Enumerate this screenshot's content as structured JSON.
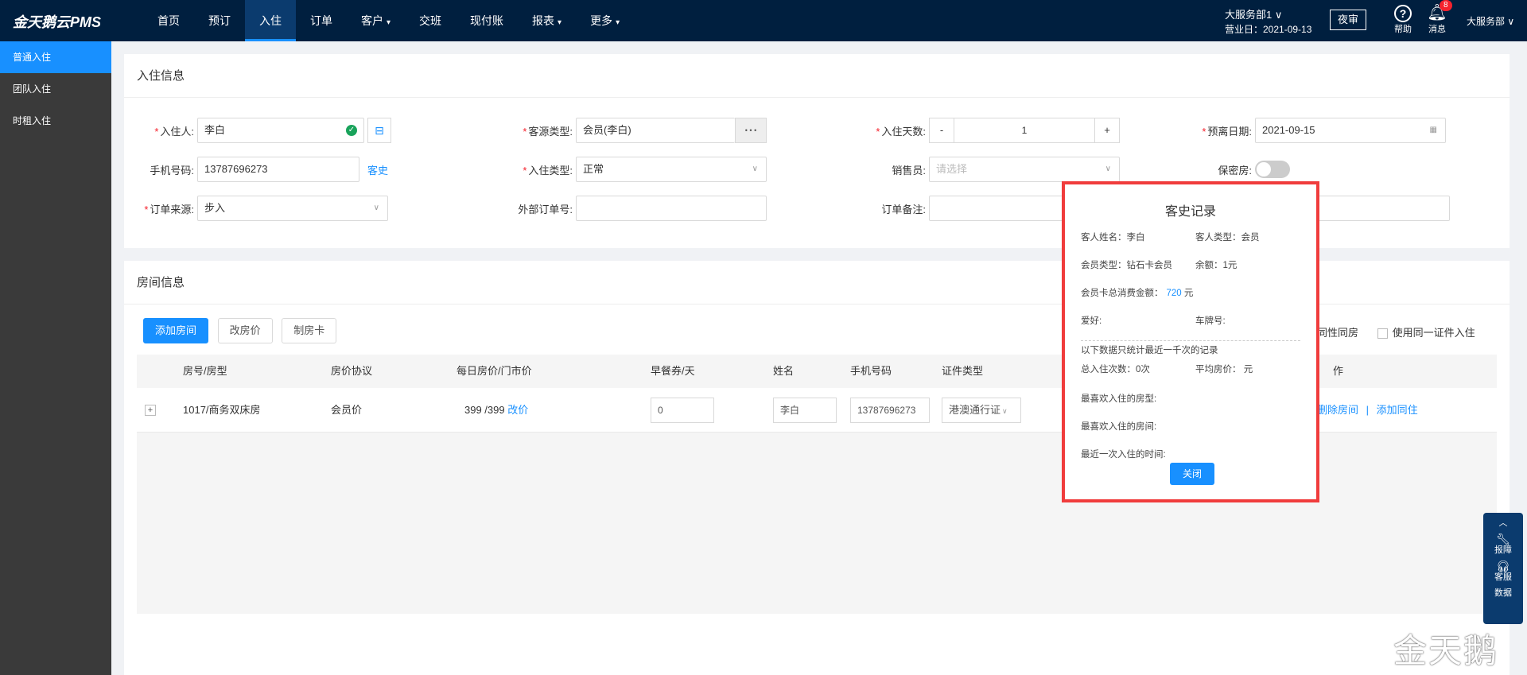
{
  "app": {
    "logo": "金天鹅云PMS"
  },
  "nav": {
    "items": [
      {
        "label": "首页",
        "caret": false
      },
      {
        "label": "预订",
        "caret": false
      },
      {
        "label": "入住",
        "caret": false,
        "active": true
      },
      {
        "label": "订单",
        "caret": false
      },
      {
        "label": "客户",
        "caret": true
      },
      {
        "label": "交班",
        "caret": false
      },
      {
        "label": "现付账",
        "caret": false
      },
      {
        "label": "报表",
        "caret": true
      },
      {
        "label": "更多",
        "caret": true
      }
    ]
  },
  "topbar": {
    "dept": "大服务部1 ∨",
    "biz_day": "营业日：2021-09-13",
    "night_audit": "夜审",
    "help": "帮助",
    "messages": "消息",
    "message_count": "8",
    "user": "大服务部 ∨"
  },
  "sidebar": {
    "items": [
      {
        "label": "普通入住",
        "active": true
      },
      {
        "label": "团队入住"
      },
      {
        "label": "时租入住"
      }
    ]
  },
  "checkin": {
    "title": "入住信息",
    "guest": {
      "label": "入住人:",
      "value": "李白"
    },
    "source_type": {
      "label": "客源类型:",
      "value": "会员(李白)",
      "more": "• • •"
    },
    "days": {
      "label": "入住天数:",
      "minus": "-",
      "value": "1",
      "plus": "+"
    },
    "departure": {
      "label": "预离日期:",
      "value": "2021-09-15"
    },
    "phone": {
      "label": "手机号码:",
      "value": "13787696273",
      "history_link": "客史"
    },
    "checkin_type": {
      "label": "入住类型:",
      "value": "正常"
    },
    "sales": {
      "label": "销售员:",
      "placeholder": "请选择"
    },
    "secret": {
      "label": "保密房:"
    },
    "order_source": {
      "label": "订单来源:",
      "value": "步入"
    },
    "external_no": {
      "label": "外部订单号:",
      "value": ""
    },
    "remark": {
      "label": "订单备注:",
      "value": ""
    }
  },
  "rooms": {
    "title": "房间信息",
    "buttons": {
      "add": "添加房间",
      "change_price": "改房价",
      "make_card": "制房卡"
    },
    "options": {
      "same_sex": "同性同房",
      "same_id": "使用同一证件入住"
    },
    "headers": {
      "room": "房号/房型",
      "protocol": "房价协议",
      "price": "每日房价/门市价",
      "breakfast": "早餐券/天",
      "name": "姓名",
      "phone": "手机号码",
      "id_type": "证件类型",
      "action": "作"
    },
    "row": {
      "expand": "+",
      "room": "1017/商务双床房",
      "protocol": "会员价",
      "price": "399 /399",
      "change_link": "改价",
      "breakfast": "0",
      "name": "李白",
      "phone": "13787696273",
      "id_type": "港澳通行证",
      "delete": "删除房间",
      "sep": "|",
      "add_companion": "添加同住"
    }
  },
  "history_popup": {
    "title": "客史记录",
    "guest_name": "客人姓名：李白",
    "guest_type": "客人类型：会员",
    "member_type": "会员类型：钻石卡会员",
    "balance": "余额：1元",
    "total_spend_label": "会员卡总消费金额：",
    "total_spend_value": "720",
    "total_spend_unit": " 元",
    "hobby": "爱好:",
    "plate": "车牌号:",
    "note": "以下数据只统计最近一千次的记录",
    "total_stays": "总入住次数：0次",
    "avg_price": "平均房价：  元",
    "fav_room_type": "最喜欢入住的房型:",
    "fav_room": "最喜欢入住的房间:",
    "last_stay": "最近一次入住的时间:",
    "close": "关闭"
  },
  "float_bar": {
    "report": "报障",
    "service": "客服",
    "data": "数据"
  },
  "watermark": "金天鹅"
}
